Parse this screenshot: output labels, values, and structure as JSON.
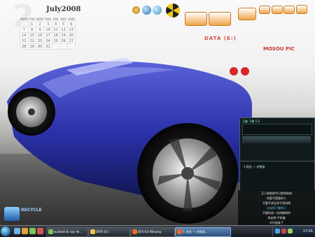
{
  "calendar": {
    "big_day": "2",
    "month_label": "July2008",
    "weekdays": [
      "MON",
      "TUE",
      "WED",
      "THU",
      "FRI",
      "SAT",
      "SUN"
    ],
    "weeks": [
      [
        "",
        "1",
        "2",
        "3",
        "4",
        "5",
        "6"
      ],
      [
        "7",
        "8",
        "9",
        "10",
        "11",
        "12",
        "13"
      ],
      [
        "14",
        "15",
        "16",
        "17",
        "18",
        "19",
        "20"
      ],
      [
        "21",
        "22",
        "23",
        "24",
        "25",
        "26",
        "27"
      ],
      [
        "28",
        "29",
        "30",
        "31",
        "",
        "",
        ""
      ]
    ]
  },
  "desktop": {
    "data_label": "DATA (E:)",
    "pic_label": "MOSOU PIC",
    "recycle_label": "RECYCLE"
  },
  "winamp": {
    "title": "万能·下载 5.5"
  },
  "playlist": {
    "row1": "1.佚名 — 对错谁"
  },
  "lyrics": {
    "lines": [
      "又人地地如今只把你的给",
      "你是不是真的人",
      "不要不求还求不亮的得",
      "过去你了解的人",
      "不要你这一次的都的样",
      "你走吧 不知道",
      "对不起谁了"
    ]
  },
  "taskbar": {
    "tasks": [
      {
        "label": "wuliaker.tk say: 亲..."
      },
      {
        "label": "DATA (E:)"
      },
      {
        "label": "DFX 8.0 Winamp"
      },
      {
        "label": "1. 佚名 — 对错谁..."
      }
    ],
    "clock": "17:01"
  },
  "colors": {
    "car_body": "#2a31a8",
    "accent_orange": "#f0a548",
    "taskbar_bg": "#1b1f25"
  },
  "icons": [
    "calendar-icon",
    "globe-icon",
    "radiation-icon",
    "folder-icon",
    "star-icon",
    "recycle-bin-icon",
    "start-orb-icon",
    "winamp-icon"
  ]
}
